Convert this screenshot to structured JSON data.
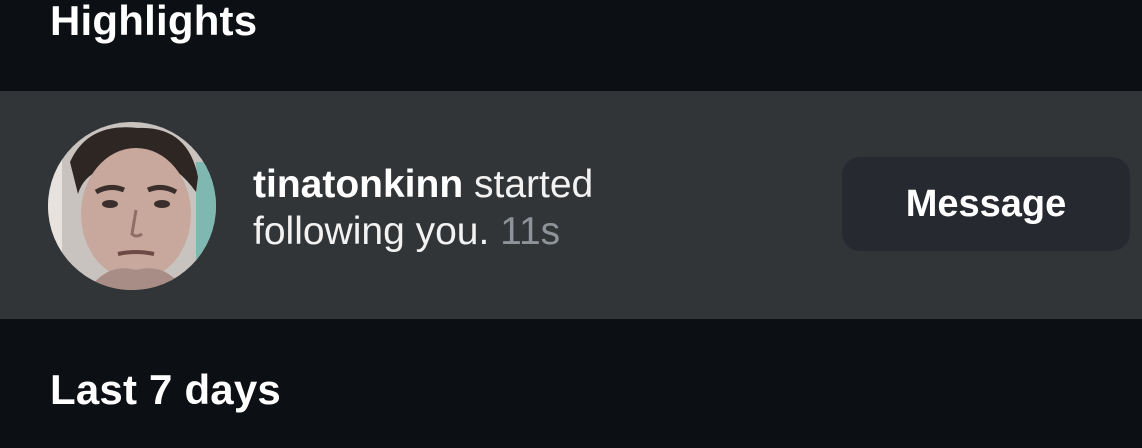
{
  "sections": {
    "highlights_title": "Highlights",
    "last7_title": "Last 7 days"
  },
  "notification": {
    "username": "tinatonkinn",
    "text_line1": "started",
    "text_line2": "following you.",
    "timestamp": "11s",
    "message_button_label": "Message",
    "avatar_icon": "user-avatar-photo"
  },
  "colors": {
    "background": "#0c0f13",
    "row_highlight": "#323538",
    "button_bg": "#262a30",
    "timestamp": "#8e9399"
  }
}
